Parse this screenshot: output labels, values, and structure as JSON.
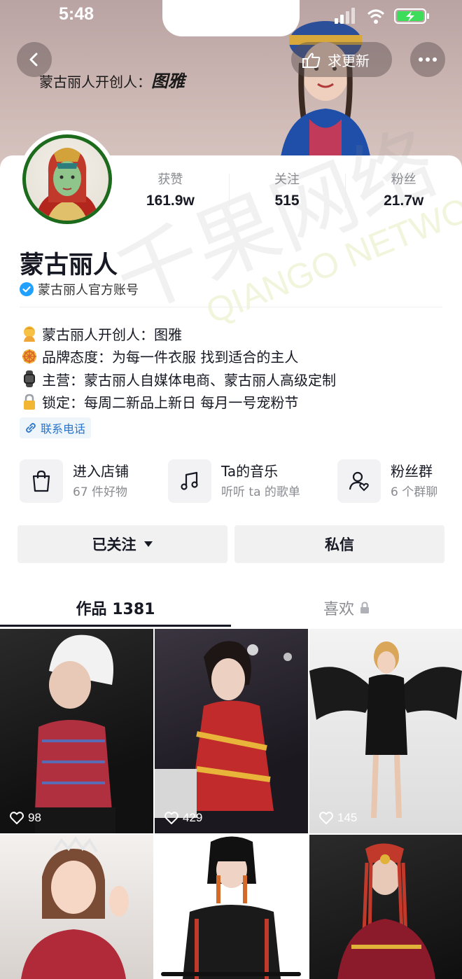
{
  "status_bar": {
    "time": "5:48"
  },
  "header": {
    "cover_title": "蒙古丽人开创人：",
    "cover_signature": "图雅",
    "update_button_label": "求更新"
  },
  "profile": {
    "name": "蒙古丽人",
    "verified_label": "蒙古丽人官方账号",
    "stats": [
      {
        "label": "获赞",
        "value": "161.9w"
      },
      {
        "label": "关注",
        "value": "515"
      },
      {
        "label": "粉丝",
        "value": "21.7w"
      }
    ],
    "bio": [
      {
        "icon": "person-emoji-icon",
        "text": "蒙古丽人开创人：图雅"
      },
      {
        "icon": "dharma-wheel-emoji-icon",
        "text": "品牌态度：为每一件衣服 找到适合的主人"
      },
      {
        "icon": "watch-emoji-icon",
        "text": "主营：蒙古丽人自媒体电商、蒙古丽人高级定制"
      },
      {
        "icon": "lock-emoji-icon",
        "text": "锁定：每周二新品上新日 每月一号宠粉节"
      }
    ],
    "contact_label": "联系电话"
  },
  "services": [
    {
      "icon": "shopping-bag-icon",
      "title": "进入店铺",
      "subtitle": "67 件好物"
    },
    {
      "icon": "music-note-icon",
      "title": "Ta的音乐",
      "subtitle": "听听 ta 的歌单"
    },
    {
      "icon": "fan-group-icon",
      "title": "粉丝群",
      "subtitle": "6 个群聊"
    }
  ],
  "actions": {
    "followed_label": "已关注",
    "message_label": "私信"
  },
  "tabs": [
    {
      "label": "作品 1381",
      "active": true
    },
    {
      "label": "喜欢",
      "active": false,
      "locked": true
    }
  ],
  "videos": [
    {
      "likes": "98"
    },
    {
      "likes": "429"
    },
    {
      "likes": "145"
    },
    {
      "likes": ""
    },
    {
      "likes": ""
    },
    {
      "likes": ""
    }
  ],
  "watermark": {
    "cn": "千果网络",
    "en": "QIANGO NETWORK"
  },
  "colors": {
    "accent_blue": "#2a74c9",
    "verified_blue": "#20a0ff",
    "text_primary": "#161823",
    "text_secondary": "#8a8b91"
  }
}
